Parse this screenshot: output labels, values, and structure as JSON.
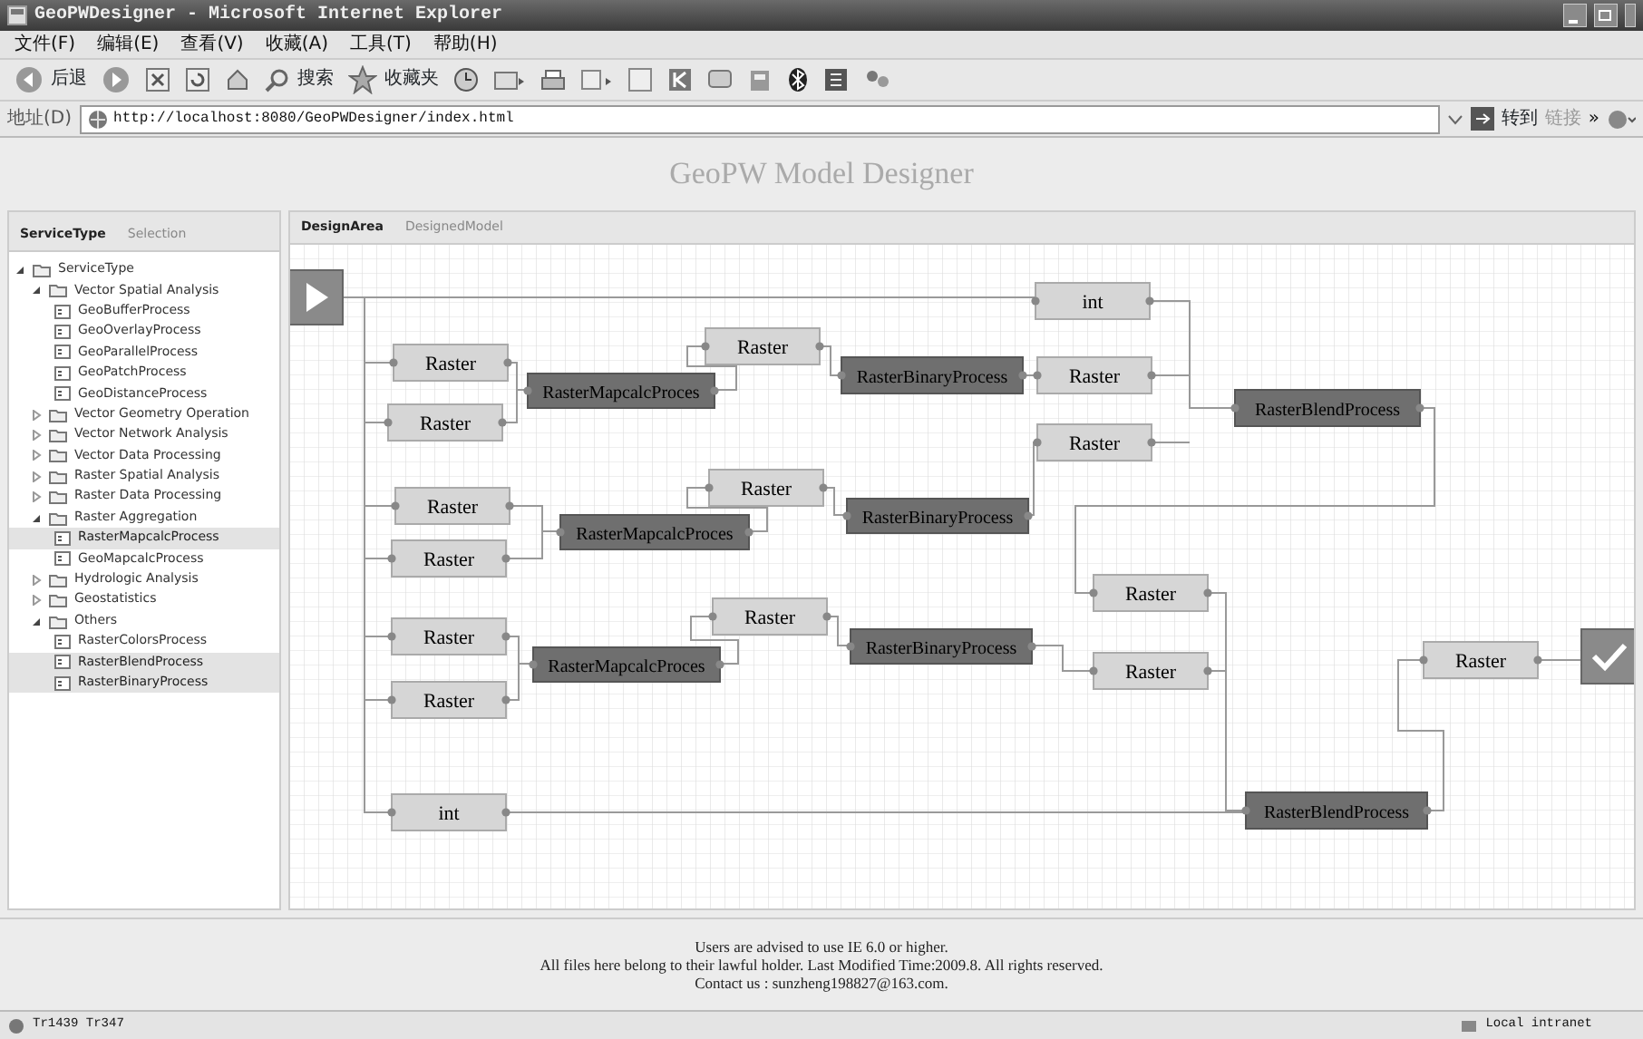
{
  "window": {
    "title": "GeoPWDesigner - Microsoft Internet Explorer"
  },
  "menu": [
    "文件(F)",
    "编辑(E)",
    "查看(V)",
    "收藏(A)",
    "工具(T)",
    "帮助(H)"
  ],
  "toolbar": {
    "back": "后退",
    "search": "搜索",
    "favorites": "收藏夹"
  },
  "address_bar": {
    "label": "地址(D)",
    "url": "http://localhost:8080/GeoPWDesigner/index.html",
    "go": "转到",
    "links": "链接",
    "more": "»"
  },
  "page": {
    "title": "GeoPW Model Designer",
    "sidebar": {
      "tabs": [
        {
          "label": "ServiceType",
          "selected": true
        },
        {
          "label": "Selection",
          "selected": false
        }
      ],
      "tree": [
        {
          "label": "ServiceType",
          "kind": "folder",
          "expanded": true,
          "children": [
            {
              "label": "Vector Spatial Analysis",
              "kind": "folder",
              "expanded": true,
              "children": [
                {
                  "label": "GeoBufferProcess",
                  "kind": "process",
                  "selected": false
                },
                {
                  "label": "GeoOverlayProcess",
                  "kind": "process",
                  "selected": false
                },
                {
                  "label": "GeoParallelProcess",
                  "kind": "process",
                  "selected": false
                },
                {
                  "label": "GeoPatchProcess",
                  "kind": "process",
                  "selected": false
                },
                {
                  "label": "GeoDistanceProcess",
                  "kind": "process",
                  "selected": false
                }
              ]
            },
            {
              "label": "Vector Geometry Operation",
              "kind": "folder",
              "expanded": false
            },
            {
              "label": "Vector Network Analysis",
              "kind": "folder",
              "expanded": false
            },
            {
              "label": "Vector Data Processing",
              "kind": "folder",
              "expanded": false
            },
            {
              "label": "Raster Spatial Analysis",
              "kind": "folder",
              "expanded": false
            },
            {
              "label": "Raster Data Processing",
              "kind": "folder",
              "expanded": false
            },
            {
              "label": "Raster Aggregation",
              "kind": "folder",
              "expanded": true,
              "children": [
                {
                  "label": "RasterMapcalcProcess",
                  "kind": "process",
                  "selected": true
                },
                {
                  "label": "GeoMapcalcProcess",
                  "kind": "process",
                  "selected": false
                }
              ]
            },
            {
              "label": "Hydrologic Analysis",
              "kind": "folder",
              "expanded": false
            },
            {
              "label": "Geostatistics",
              "kind": "folder",
              "expanded": false
            },
            {
              "label": "Others",
              "kind": "folder",
              "expanded": true,
              "children": [
                {
                  "label": "RasterColorsProcess",
                  "kind": "process",
                  "selected": false
                },
                {
                  "label": "RasterBlendProcess",
                  "kind": "process",
                  "selected": true
                },
                {
                  "label": "RasterBinaryProcess",
                  "kind": "process",
                  "selected": true
                }
              ]
            }
          ]
        }
      ]
    },
    "design": {
      "tabs": [
        {
          "label": "DesignArea",
          "selected": true
        },
        {
          "label": "DesignedModel",
          "selected": false
        }
      ],
      "nodes": [
        {
          "kind": "start"
        },
        {
          "kind": "data",
          "label": "int"
        },
        {
          "kind": "data",
          "label": "Raster"
        },
        {
          "kind": "data",
          "label": "Raster"
        },
        {
          "kind": "process",
          "label": "RasterMapcalcProces"
        },
        {
          "kind": "data",
          "label": "Raster"
        },
        {
          "kind": "process",
          "label": "RasterBinaryProcess"
        },
        {
          "kind": "data",
          "label": "Raster"
        },
        {
          "kind": "data",
          "label": "Raster"
        },
        {
          "kind": "process",
          "label": "RasterBlendProcess"
        },
        {
          "kind": "data",
          "label": "Raster"
        },
        {
          "kind": "data",
          "label": "Raster"
        },
        {
          "kind": "process",
          "label": "RasterMapcalcProces"
        },
        {
          "kind": "data",
          "label": "Raster"
        },
        {
          "kind": "process",
          "label": "RasterBinaryProcess"
        },
        {
          "kind": "data",
          "label": "Raster"
        },
        {
          "kind": "data",
          "label": "Raster"
        },
        {
          "kind": "data",
          "label": "Raster"
        },
        {
          "kind": "process",
          "label": "RasterMapcalcProces"
        },
        {
          "kind": "data",
          "label": "Raster"
        },
        {
          "kind": "process",
          "label": "RasterBinaryProcess"
        },
        {
          "kind": "data",
          "label": "Raster"
        },
        {
          "kind": "data",
          "label": "Raster"
        },
        {
          "kind": "end"
        },
        {
          "kind": "data",
          "label": "int"
        },
        {
          "kind": "process",
          "label": "RasterBlendProcess"
        }
      ]
    },
    "footer": [
      "Users are advised to use IE 6.0 or higher.",
      "All files here belong to their lawful holder. Last Modified Time:2009.8. All rights reserved.",
      "Contact us : sunzheng198827@163.com."
    ]
  },
  "status_bar": {
    "text": "Tr1439 Tr347",
    "zone": "Local intranet"
  }
}
